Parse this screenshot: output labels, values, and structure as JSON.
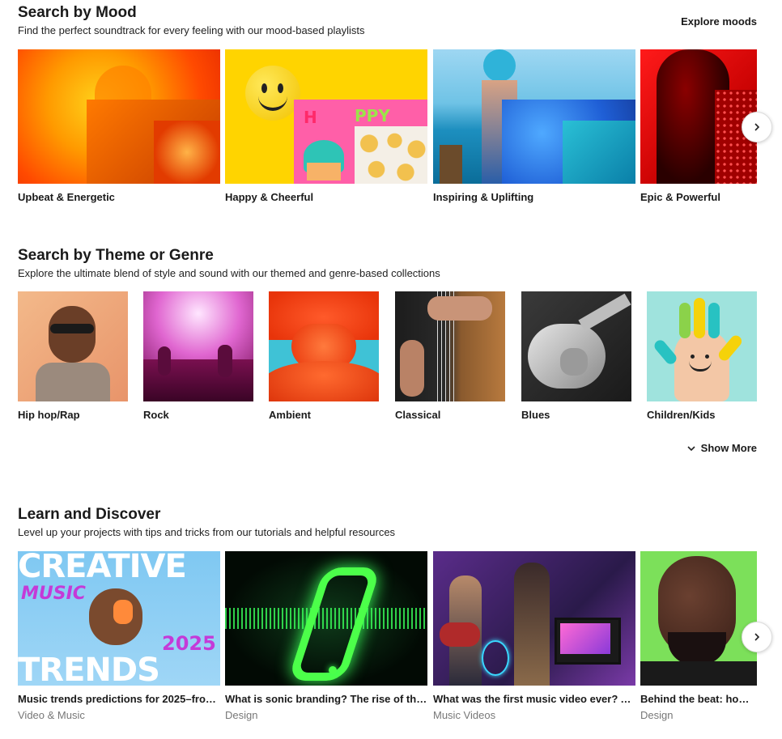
{
  "mood": {
    "title": "Search by Mood",
    "subtitle": "Find the perfect soundtrack for every feeling with our mood-based playlists",
    "link": "Explore moods",
    "cards": [
      {
        "label": "Upbeat & Energetic"
      },
      {
        "label": "Happy & Cheerful"
      },
      {
        "label": "Inspiring & Uplifting"
      },
      {
        "label": "Epic & Powerful"
      }
    ],
    "next_icon": "chevron-right-icon"
  },
  "genre": {
    "title": "Search by Theme or Genre",
    "subtitle": "Explore the ultimate blend of style and sound with our themed and genre-based collections",
    "cards": [
      {
        "label": "Hip hop/Rap"
      },
      {
        "label": "Rock"
      },
      {
        "label": "Ambient"
      },
      {
        "label": "Classical"
      },
      {
        "label": "Blues"
      },
      {
        "label": "Children/Kids"
      }
    ],
    "show_more": "Show More",
    "show_more_icon": "chevron-down-icon"
  },
  "learn": {
    "title": "Learn and Discover",
    "subtitle": "Level up your projects with tips and tricks from our tutorials and helpful resources",
    "cards": [
      {
        "title": "Music trends predictions for 2025–fro…",
        "category": "Video & Music",
        "overlay_top": "CREATIVE",
        "overlay_mid": "MUSIC",
        "overlay_year": "2025",
        "overlay_bottom": "TRENDS"
      },
      {
        "title": "What is sonic branding? The rise of the …",
        "category": "Design"
      },
      {
        "title": "What was the first music video ever? A …",
        "category": "Music Videos"
      },
      {
        "title": "Behind the beat: how Ne",
        "category": "Design"
      }
    ],
    "next_icon": "chevron-right-icon"
  }
}
